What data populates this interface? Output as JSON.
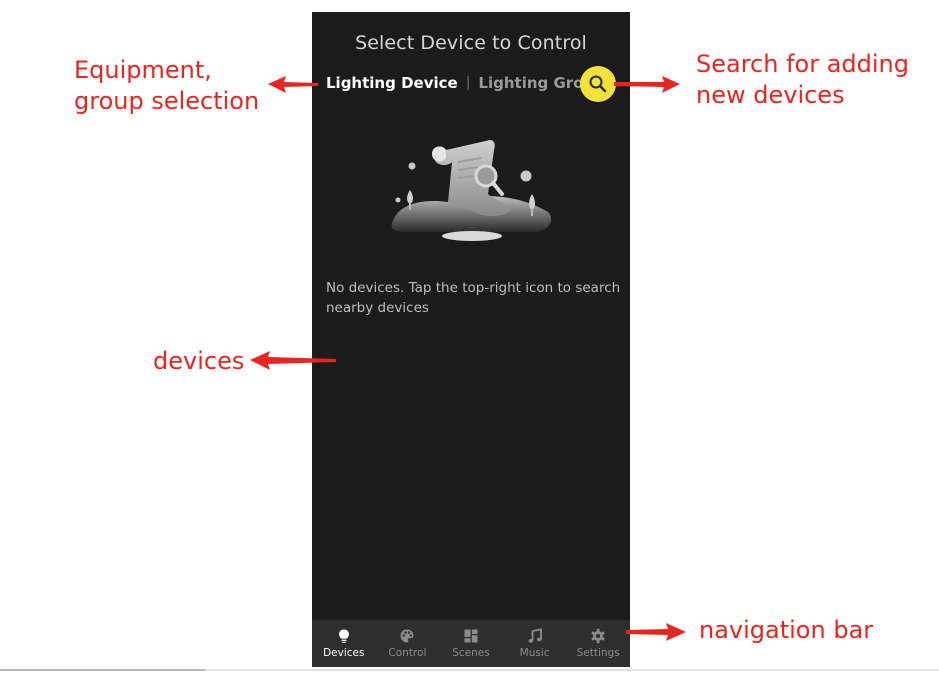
{
  "header": {
    "title": "Select Device to Control"
  },
  "tabs": {
    "active": "Lighting Device",
    "separator": "|",
    "inactive": "Lighting Group"
  },
  "search_button": {
    "icon": "search-icon",
    "color": "#f3e23a"
  },
  "empty_state": {
    "illustration": "empty-document-illustration",
    "message": "No devices. Tap the top-right icon to search nearby devices"
  },
  "navbar": {
    "items": [
      {
        "label": "Devices",
        "icon": "bulb-icon",
        "active": true
      },
      {
        "label": "Control",
        "icon": "palette-icon",
        "active": false
      },
      {
        "label": "Scenes",
        "icon": "grid-icon",
        "active": false
      },
      {
        "label": "Music",
        "icon": "music-note-icon",
        "active": false
      },
      {
        "label": "Settings",
        "icon": "gear-icon",
        "active": false
      }
    ]
  },
  "annotations": {
    "equipment_line1": "Equipment,",
    "equipment_line2": "group selection",
    "search_line1": "Search for adding",
    "search_line2": "new devices",
    "devices": "devices",
    "navigation": "navigation bar",
    "color": "#e8261f"
  }
}
